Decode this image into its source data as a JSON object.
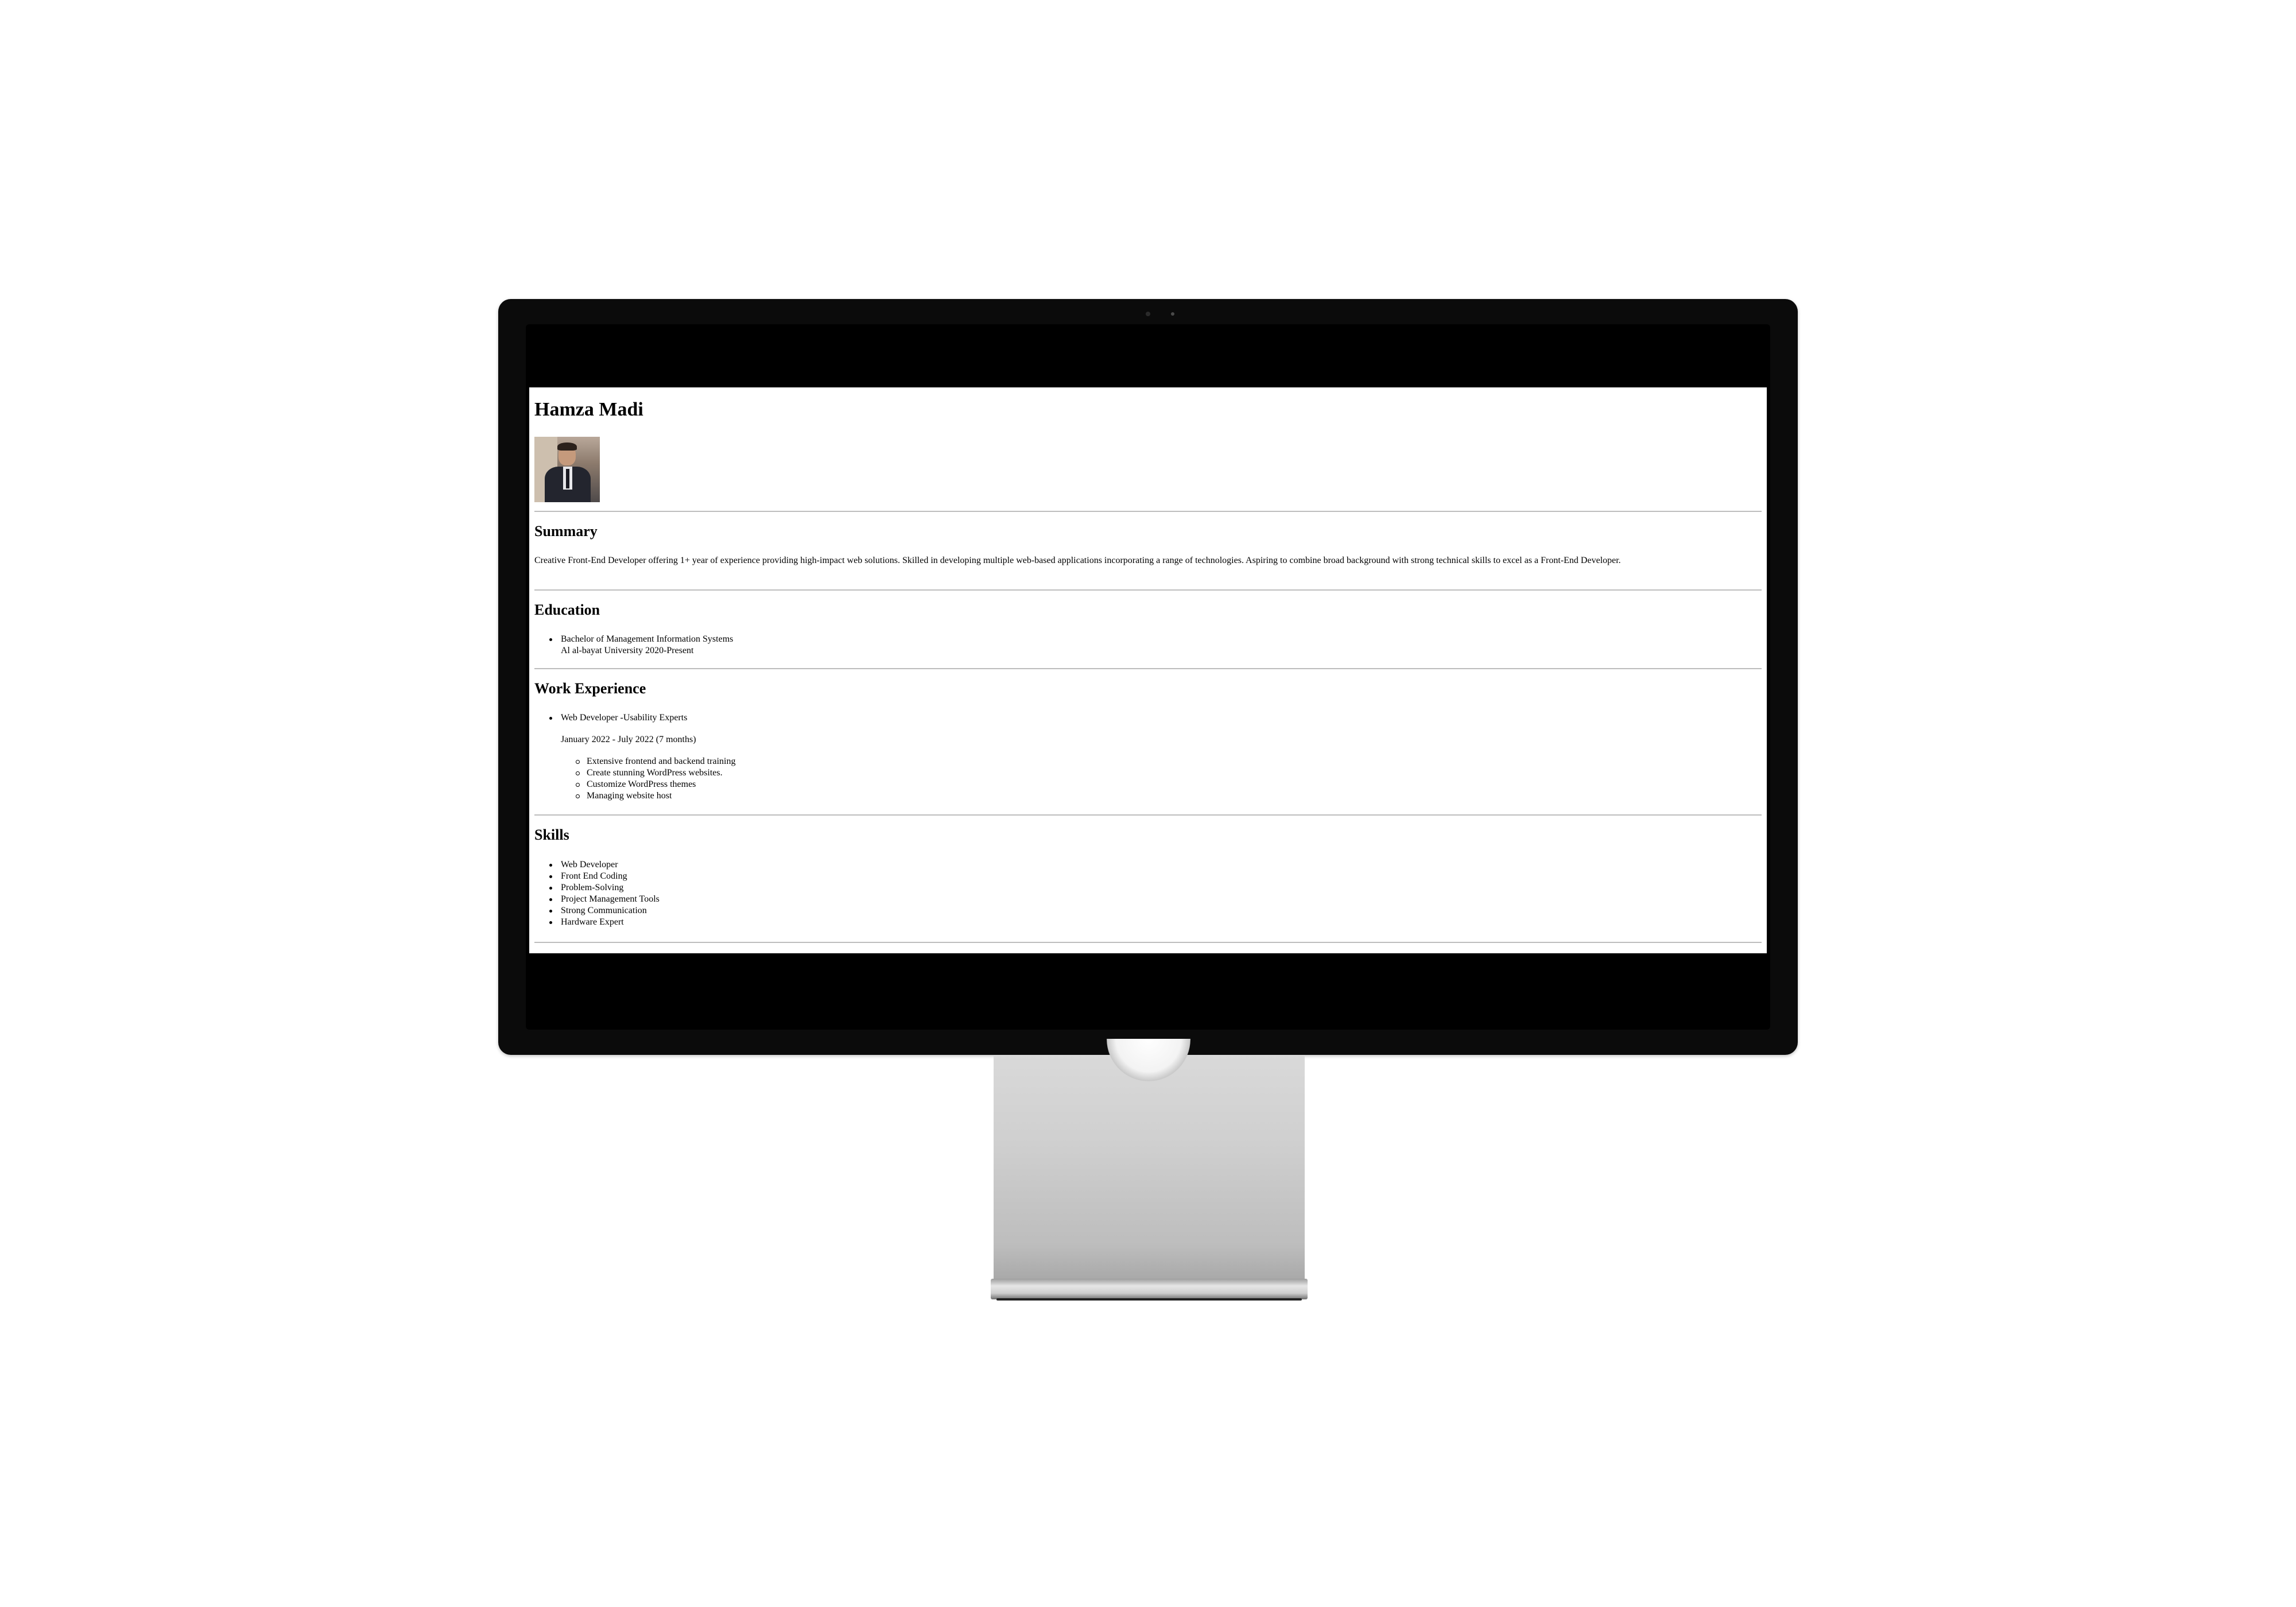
{
  "resume": {
    "name": "Hamza Madi",
    "summary": {
      "heading": "Summary",
      "text": "Creative Front-End Developer offering 1+ year of experience providing high-impact web solutions. Skilled in developing multiple web-based applications incorporating a range of technologies. Aspiring to combine broad background with strong technical skills to excel as a Front-End Developer."
    },
    "education": {
      "heading": "Education",
      "items": [
        {
          "line1": "Bachelor of Management Information Systems",
          "line2": "Al al-bayat University 2020-Present"
        }
      ]
    },
    "work": {
      "heading": "Work Experience",
      "items": [
        {
          "title": "Web Developer -Usability Experts",
          "period": "January 2022 - July 2022 (7 months)",
          "tasks": [
            "Extensive frontend and backend training",
            "Create stunning WordPress websites.",
            "Customize WordPress themes",
            "Managing website host"
          ]
        }
      ]
    },
    "skills": {
      "heading": "Skills",
      "items": [
        "Web Developer",
        "Front End Coding",
        "Problem-Solving",
        "Project Management Tools",
        "Strong Communication",
        "Hardware Expert"
      ]
    }
  }
}
